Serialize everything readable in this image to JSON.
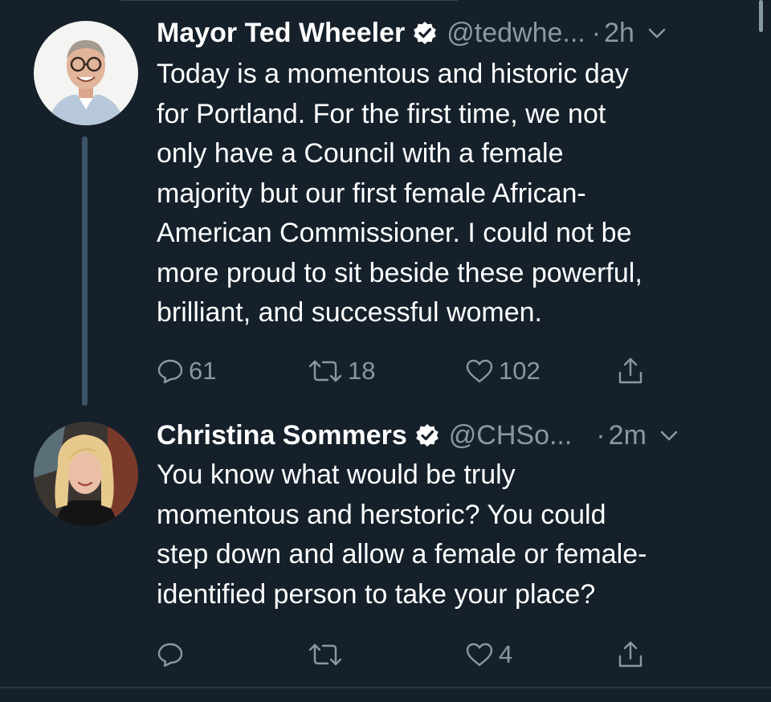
{
  "colors": {
    "background": "#15202b",
    "text": "#ffffff",
    "muted": "#8899a6",
    "thread_line": "#3d5466",
    "divider": "#2a3640"
  },
  "tweets": [
    {
      "name": "Mayor Ted Wheeler",
      "verified": true,
      "handle": "@tedwhe...",
      "dot": "·",
      "time": "2h",
      "text": "Today is a momentous and historic day\nfor Portland. For the first time, we not\nonly have a Council with a female\nmajority but our first female African-\nAmerican Commissioner. I could not be\nmore proud to sit beside these powerful,\nbrilliant, and successful women.",
      "reply_count": "61",
      "retweet_count": "18",
      "like_count": "102",
      "icons": [
        "reply-icon",
        "retweet-icon",
        "like-icon",
        "share-icon"
      ]
    },
    {
      "name": "Christina Sommers",
      "verified": true,
      "handle": "@CHSo...",
      "dot": "·",
      "time": "2m",
      "text": "You know what would be truly\nmomentous and herstoric? You could\nstep down and allow a female or female-\nidentified person to take your place?",
      "reply_count": "",
      "retweet_count": "",
      "like_count": "4",
      "icons": [
        "reply-icon",
        "retweet-icon",
        "like-icon",
        "share-icon"
      ]
    }
  ]
}
